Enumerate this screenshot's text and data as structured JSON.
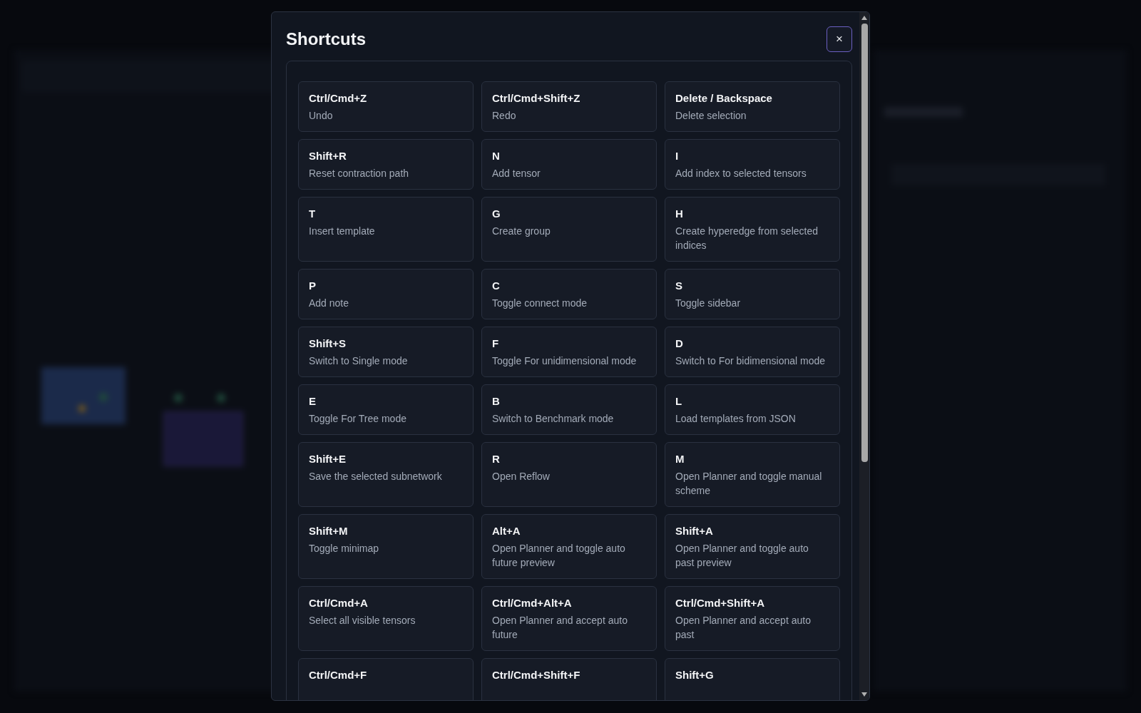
{
  "dialog": {
    "title": "Shortcuts",
    "close": "×",
    "shortcuts": [
      {
        "keys": "Ctrl/Cmd+Z",
        "action": "Undo"
      },
      {
        "keys": "Ctrl/Cmd+Shift+Z",
        "action": "Redo"
      },
      {
        "keys": "Delete / Backspace",
        "action": "Delete selection"
      },
      {
        "keys": "Shift+R",
        "action": "Reset contraction path"
      },
      {
        "keys": "N",
        "action": "Add tensor"
      },
      {
        "keys": "I",
        "action": "Add index to selected tensors"
      },
      {
        "keys": "T",
        "action": "Insert template"
      },
      {
        "keys": "G",
        "action": "Create group"
      },
      {
        "keys": "H",
        "action": "Create hyperedge from selected indices"
      },
      {
        "keys": "P",
        "action": "Add note"
      },
      {
        "keys": "C",
        "action": "Toggle connect mode"
      },
      {
        "keys": "S",
        "action": "Toggle sidebar"
      },
      {
        "keys": "Shift+S",
        "action": "Switch to Single mode"
      },
      {
        "keys": "F",
        "action": "Toggle For unidimensional mode"
      },
      {
        "keys": "D",
        "action": "Switch to For bidimensional mode"
      },
      {
        "keys": "E",
        "action": "Toggle For Tree mode"
      },
      {
        "keys": "B",
        "action": "Switch to Benchmark mode"
      },
      {
        "keys": "L",
        "action": "Load templates from JSON"
      },
      {
        "keys": "Shift+E",
        "action": "Save the selected subnetwork"
      },
      {
        "keys": "R",
        "action": "Open Reflow"
      },
      {
        "keys": "M",
        "action": "Open Planner and toggle manual scheme"
      },
      {
        "keys": "Shift+M",
        "action": "Toggle minimap"
      },
      {
        "keys": "Alt+A",
        "action": "Open Planner and toggle auto future preview"
      },
      {
        "keys": "Shift+A",
        "action": "Open Planner and toggle auto past preview"
      },
      {
        "keys": "Ctrl/Cmd+A",
        "action": "Select all visible tensors"
      },
      {
        "keys": "Ctrl/Cmd+Alt+A",
        "action": "Open Planner and accept auto future"
      },
      {
        "keys": "Ctrl/Cmd+Shift+A",
        "action": "Open Planner and accept auto past"
      },
      {
        "keys": "Ctrl/Cmd+F"
      },
      {
        "keys": "Ctrl/Cmd+Shift+F"
      },
      {
        "keys": "Shift+G"
      }
    ]
  }
}
